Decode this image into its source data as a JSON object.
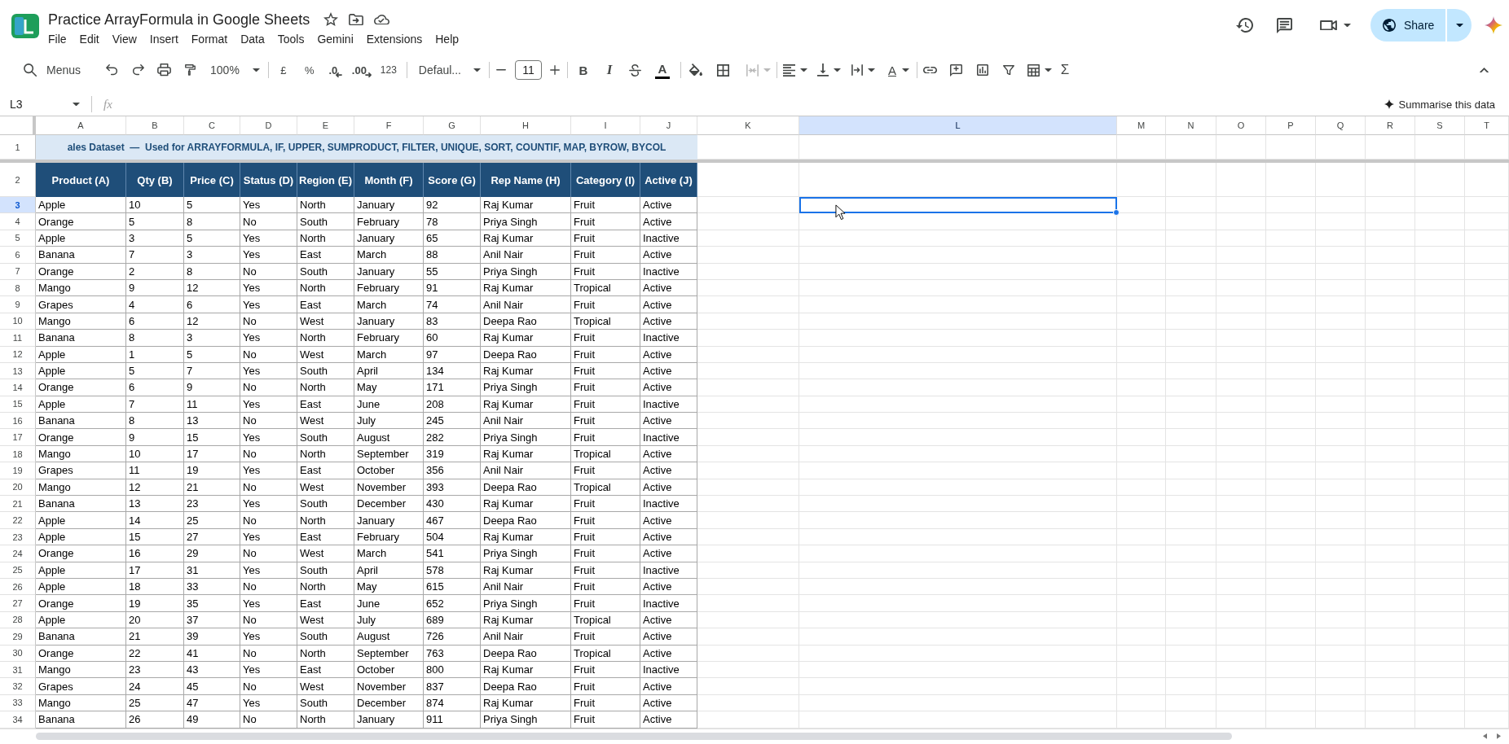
{
  "document": {
    "title": "Practice ArrayFormula in Google Sheets"
  },
  "menu": [
    "File",
    "Edit",
    "View",
    "Insert",
    "Format",
    "Data",
    "Tools",
    "Gemini",
    "Extensions",
    "Help"
  ],
  "share": {
    "label": "Share"
  },
  "toolbar": {
    "search_label": "Menus",
    "zoom": "100%",
    "currency": "£",
    "percent": "%",
    "decrease_decimals": ".0",
    "increase_decimals": ".00",
    "number_format": "123",
    "font": "Defaul...",
    "font_size": "11",
    "bold": "B",
    "italic": "I",
    "text_color": "A",
    "merge_cells": {
      "disabled": true
    },
    "text_rotation": "A",
    "functions": "Σ"
  },
  "formula_bar": {
    "cell_reference": "L3",
    "function_label": "fx"
  },
  "summarise": {
    "label": "Summarise this data"
  },
  "sheet": {
    "columns": [
      {
        "label": "A",
        "selected": false
      },
      {
        "label": "B",
        "selected": false
      },
      {
        "label": "C",
        "selected": false
      },
      {
        "label": "D",
        "selected": false
      },
      {
        "label": "E",
        "selected": false
      },
      {
        "label": "F",
        "selected": false
      },
      {
        "label": "G",
        "selected": false
      },
      {
        "label": "H",
        "selected": false
      },
      {
        "label": "I",
        "selected": false
      },
      {
        "label": "J",
        "selected": false
      },
      {
        "label": "K",
        "selected": false
      },
      {
        "label": "L",
        "selected": true
      },
      {
        "label": "M",
        "selected": false
      },
      {
        "label": "N",
        "selected": false
      },
      {
        "label": "O",
        "selected": false
      },
      {
        "label": "P",
        "selected": false
      },
      {
        "label": "Q",
        "selected": false
      },
      {
        "label": "R",
        "selected": false
      },
      {
        "label": "S",
        "selected": false
      },
      {
        "label": "T",
        "selected": false
      }
    ],
    "rows": [
      {
        "number": "1",
        "selected": false,
        "kind": "banner",
        "text": "ales Dataset  —  Used for ARRAYFORMULA, IF, UPPER, SUMPRODUCT, FILTER, UNIQUE, SORT, COUNTIF, MAP, BYROW, BYCOL"
      },
      {
        "number": "2",
        "selected": false,
        "kind": "header",
        "cells": [
          "Product (A)",
          "Qty (B)",
          "Price (C)",
          "Status (D)",
          "Region (E)",
          "Month (F)",
          "Score (G)",
          "Rep Name (H)",
          "Category (I)",
          "Active (J)"
        ]
      },
      {
        "number": "3",
        "selected": true,
        "kind": "data",
        "cells": [
          "Apple",
          "10",
          "5",
          "Yes",
          "North",
          "January",
          "92",
          "Raj Kumar",
          "Fruit",
          "Active"
        ]
      },
      {
        "number": "4",
        "selected": false,
        "kind": "data",
        "cells": [
          "Orange",
          "5",
          "8",
          "No",
          "South",
          "February",
          "78",
          "Priya Singh",
          "Fruit",
          "Active"
        ]
      },
      {
        "number": "5",
        "selected": false,
        "kind": "data",
        "cells": [
          "Apple",
          "3",
          "5",
          "Yes",
          "North",
          "January",
          "65",
          "Raj Kumar",
          "Fruit",
          "Inactive"
        ]
      },
      {
        "number": "6",
        "selected": false,
        "kind": "data",
        "cells": [
          "Banana",
          "7",
          "3",
          "Yes",
          "East",
          "March",
          "88",
          "Anil Nair",
          "Fruit",
          "Active"
        ]
      },
      {
        "number": "7",
        "selected": false,
        "kind": "data",
        "cells": [
          "Orange",
          "2",
          "8",
          "No",
          "South",
          "January",
          "55",
          "Priya Singh",
          "Fruit",
          "Inactive"
        ]
      },
      {
        "number": "8",
        "selected": false,
        "kind": "data",
        "cells": [
          "Mango",
          "9",
          "12",
          "Yes",
          "North",
          "February",
          "91",
          "Raj Kumar",
          "Tropical",
          "Active"
        ]
      },
      {
        "number": "9",
        "selected": false,
        "kind": "data",
        "cells": [
          "Grapes",
          "4",
          "6",
          "Yes",
          "East",
          "March",
          "74",
          "Anil Nair",
          "Fruit",
          "Active"
        ]
      },
      {
        "number": "10",
        "selected": false,
        "kind": "data",
        "cells": [
          "Mango",
          "6",
          "12",
          "No",
          "West",
          "January",
          "83",
          "Deepa Rao",
          "Tropical",
          "Active"
        ]
      },
      {
        "number": "11",
        "selected": false,
        "kind": "data",
        "cells": [
          "Banana",
          "8",
          "3",
          "Yes",
          "North",
          "February",
          "60",
          "Raj Kumar",
          "Fruit",
          "Inactive"
        ]
      },
      {
        "number": "12",
        "selected": false,
        "kind": "data",
        "cells": [
          "Apple",
          "1",
          "5",
          "No",
          "West",
          "March",
          "97",
          "Deepa Rao",
          "Fruit",
          "Active"
        ]
      },
      {
        "number": "13",
        "selected": false,
        "kind": "data",
        "cells": [
          "Apple",
          "5",
          "7",
          "Yes",
          "South",
          "April",
          "134",
          "Raj Kumar",
          "Fruit",
          "Active"
        ]
      },
      {
        "number": "14",
        "selected": false,
        "kind": "data",
        "cells": [
          "Orange",
          "6",
          "9",
          "No",
          "North",
          "May",
          "171",
          "Priya Singh",
          "Fruit",
          "Active"
        ]
      },
      {
        "number": "15",
        "selected": false,
        "kind": "data",
        "cells": [
          "Apple",
          "7",
          "11",
          "Yes",
          "East",
          "June",
          "208",
          "Raj Kumar",
          "Fruit",
          "Inactive"
        ]
      },
      {
        "number": "16",
        "selected": false,
        "kind": "data",
        "cells": [
          "Banana",
          "8",
          "13",
          "No",
          "West",
          "July",
          "245",
          "Anil Nair",
          "Fruit",
          "Active"
        ]
      },
      {
        "number": "17",
        "selected": false,
        "kind": "data",
        "cells": [
          "Orange",
          "9",
          "15",
          "Yes",
          "South",
          "August",
          "282",
          "Priya Singh",
          "Fruit",
          "Inactive"
        ]
      },
      {
        "number": "18",
        "selected": false,
        "kind": "data",
        "cells": [
          "Mango",
          "10",
          "17",
          "No",
          "North",
          "September",
          "319",
          "Raj Kumar",
          "Tropical",
          "Active"
        ]
      },
      {
        "number": "19",
        "selected": false,
        "kind": "data",
        "cells": [
          "Grapes",
          "11",
          "19",
          "Yes",
          "East",
          "October",
          "356",
          "Anil Nair",
          "Fruit",
          "Active"
        ]
      },
      {
        "number": "20",
        "selected": false,
        "kind": "data",
        "cells": [
          "Mango",
          "12",
          "21",
          "No",
          "West",
          "November",
          "393",
          "Deepa Rao",
          "Tropical",
          "Active"
        ]
      },
      {
        "number": "21",
        "selected": false,
        "kind": "data",
        "cells": [
          "Banana",
          "13",
          "23",
          "Yes",
          "South",
          "December",
          "430",
          "Raj Kumar",
          "Fruit",
          "Inactive"
        ]
      },
      {
        "number": "22",
        "selected": false,
        "kind": "data",
        "cells": [
          "Apple",
          "14",
          "25",
          "No",
          "North",
          "January",
          "467",
          "Deepa Rao",
          "Fruit",
          "Active"
        ]
      },
      {
        "number": "23",
        "selected": false,
        "kind": "data",
        "cells": [
          "Apple",
          "15",
          "27",
          "Yes",
          "East",
          "February",
          "504",
          "Raj Kumar",
          "Fruit",
          "Active"
        ]
      },
      {
        "number": "24",
        "selected": false,
        "kind": "data",
        "cells": [
          "Orange",
          "16",
          "29",
          "No",
          "West",
          "March",
          "541",
          "Priya Singh",
          "Fruit",
          "Active"
        ]
      },
      {
        "number": "25",
        "selected": false,
        "kind": "data",
        "cells": [
          "Apple",
          "17",
          "31",
          "Yes",
          "South",
          "April",
          "578",
          "Raj Kumar",
          "Fruit",
          "Inactive"
        ]
      },
      {
        "number": "26",
        "selected": false,
        "kind": "data",
        "cells": [
          "Apple",
          "18",
          "33",
          "No",
          "North",
          "May",
          "615",
          "Anil Nair",
          "Fruit",
          "Active"
        ]
      },
      {
        "number": "27",
        "selected": false,
        "kind": "data",
        "cells": [
          "Orange",
          "19",
          "35",
          "Yes",
          "East",
          "June",
          "652",
          "Priya Singh",
          "Fruit",
          "Inactive"
        ]
      },
      {
        "number": "28",
        "selected": false,
        "kind": "data",
        "cells": [
          "Apple",
          "20",
          "37",
          "No",
          "West",
          "July",
          "689",
          "Raj Kumar",
          "Tropical",
          "Active"
        ]
      },
      {
        "number": "29",
        "selected": false,
        "kind": "data",
        "cells": [
          "Banana",
          "21",
          "39",
          "Yes",
          "South",
          "August",
          "726",
          "Anil Nair",
          "Fruit",
          "Active"
        ]
      },
      {
        "number": "30",
        "selected": false,
        "kind": "data",
        "cells": [
          "Orange",
          "22",
          "41",
          "No",
          "North",
          "September",
          "763",
          "Deepa Rao",
          "Tropical",
          "Active"
        ]
      },
      {
        "number": "31",
        "selected": false,
        "kind": "data",
        "cells": [
          "Mango",
          "23",
          "43",
          "Yes",
          "East",
          "October",
          "800",
          "Raj Kumar",
          "Fruit",
          "Inactive"
        ]
      },
      {
        "number": "32",
        "selected": false,
        "kind": "data",
        "cells": [
          "Grapes",
          "24",
          "45",
          "No",
          "West",
          "November",
          "837",
          "Deepa Rao",
          "Fruit",
          "Active"
        ]
      },
      {
        "number": "33",
        "selected": false,
        "kind": "data",
        "cells": [
          "Mango",
          "25",
          "47",
          "Yes",
          "South",
          "December",
          "874",
          "Raj Kumar",
          "Fruit",
          "Active"
        ]
      },
      {
        "number": "34",
        "selected": false,
        "kind": "data",
        "cells": [
          "Banana",
          "26",
          "49",
          "No",
          "North",
          "January",
          "911",
          "Priya Singh",
          "Fruit",
          "Active"
        ]
      }
    ]
  }
}
